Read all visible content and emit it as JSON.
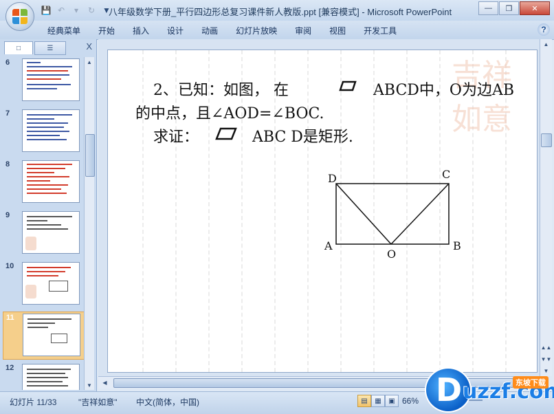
{
  "window": {
    "title": "八年级数学下册_平行四边形总复习课件新人教版.ppt [兼容模式] - Microsoft PowerPoint"
  },
  "ribbon": {
    "tabs": [
      "经典菜单",
      "开始",
      "插入",
      "设计",
      "动画",
      "幻灯片放映",
      "审阅",
      "视图",
      "开发工具"
    ]
  },
  "slides_panel": {
    "close_label": "X",
    "numbers": [
      "6",
      "7",
      "8",
      "9",
      "10",
      "11",
      "12"
    ],
    "selected": "11"
  },
  "slide": {
    "line1": "2、已知：如图，  在",
    "line1b": "ABCD中，O为边AB",
    "line2": "的中点，且∠AOD=∠BOC.",
    "line3a": "求证：",
    "line3b": "ABC D是矩形.",
    "points": {
      "A": "A",
      "B": "B",
      "C": "C",
      "D": "D",
      "O": "O"
    },
    "seal_chars": "吉祥如意"
  },
  "status": {
    "slide_info": "幻灯片 11/33",
    "theme": "\"吉祥如意\"",
    "language": "中文(简体，中国)",
    "zoom": "66%"
  },
  "watermark": {
    "brand": "uzzf.com",
    "tag": "东坡下载",
    "letter": "D"
  }
}
